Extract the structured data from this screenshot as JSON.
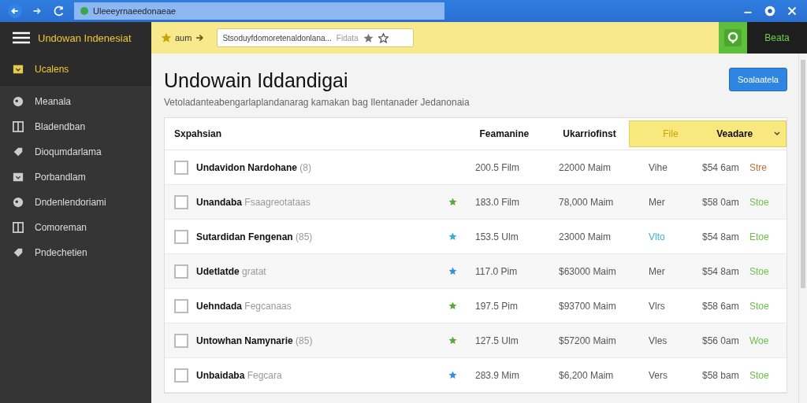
{
  "browser": {
    "address": "Uleeeyrnaeedonaeae"
  },
  "app": {
    "title": "Undowan Indenesiat",
    "shortcut": "aum",
    "search": {
      "value": "Stsoduyfdomoretenaldonlana...",
      "hint": "Fidata"
    },
    "account": "Beata"
  },
  "sidebar": {
    "items": [
      {
        "label": "Ucalens",
        "selected": true
      },
      {
        "label": "Meanala",
        "selected": false
      },
      {
        "label": "Bladendban",
        "selected": false
      },
      {
        "label": "Dioqumdarlama",
        "selected": false
      },
      {
        "label": "Porbandlam",
        "selected": false
      },
      {
        "label": "Dndenlendoriami",
        "selected": false
      },
      {
        "label": "Comoreman",
        "selected": false
      },
      {
        "label": "Pndechetien",
        "selected": false
      }
    ]
  },
  "page": {
    "title": "Undowain Iddandigai",
    "subtitle": "Vetoladanteabengarlaplandanarag kamakan bag Ilentanader Jedanonaia",
    "button": "Soalaatela"
  },
  "table": {
    "columns": [
      {
        "label": "Sxpahsian",
        "highlighted": false
      },
      {
        "label": "Feamanine",
        "highlighted": false
      },
      {
        "label": "Ukarriofinst",
        "highlighted": false
      },
      {
        "label": "File",
        "highlighted": true
      },
      {
        "label": "Veadare",
        "highlighted": true
      }
    ],
    "rows": [
      {
        "checked": false,
        "name": "**Undavidon Nardohane** (8)",
        "size": "200.5 Film",
        "count": "22000 Maim",
        "type": {
          "text": "Vihe"
        },
        "price": "$54 6am",
        "status": {
          "text": "Stre",
          "color": "#c0703a"
        }
      },
      {
        "checked": false,
        "name": "**Unandaba** Fsaagreotataas",
        "star": {
          "color": "#5aa83a"
        },
        "size": "183.0 Film",
        "count": "78,000 Maim",
        "type": {
          "text": "Mer"
        },
        "price": "$58 0am",
        "status": {
          "text": "Stoe",
          "color": "#6cc04a"
        }
      },
      {
        "checked": false,
        "name": "**Sutardidan Fengenan** (85)",
        "star": {
          "color": "#3bb0c9"
        },
        "size": "153.5 Ulm",
        "count": "23000 Maim",
        "type": {
          "text": "Vlto",
          "color": "#3bb0c9"
        },
        "price": "$54 8am",
        "status": {
          "text": "Etoe",
          "color": "#6cc04a"
        }
      },
      {
        "checked": false,
        "name": "**Udetlatde** gratat",
        "star": {
          "color": "#3a8ee0"
        },
        "size": "117.0 Pim",
        "count": "$63000 Maim",
        "type": {
          "text": "Mer"
        },
        "price": "$54 8am",
        "status": {
          "text": "Stoe",
          "color": "#6cc04a"
        }
      },
      {
        "checked": false,
        "name": "**Uehndada** Fegcanaas",
        "star": {
          "color": "#5aa83a"
        },
        "size": "197.5 Pim",
        "count": "$93700 Maim",
        "type": {
          "text": "Vlrs"
        },
        "price": "$58 6am",
        "status": {
          "text": "Stoe",
          "color": "#6cc04a"
        }
      },
      {
        "checked": false,
        "name": "**Untowhan Namynarie** (85)",
        "star": {
          "color": "#5aa83a"
        },
        "size": "127.5 Ulm",
        "count": "$57200 Maim",
        "type": {
          "text": "Vles"
        },
        "price": "$56 0am",
        "status": {
          "text": "Woe",
          "color": "#6cc04a"
        }
      },
      {
        "checked": false,
        "name": "**Unbaidaba** Fegcara",
        "star": {
          "color": "#3a8ee0"
        },
        "size": "283.9 Mim",
        "count": "$6,200 Maim",
        "type": {
          "text": "Vers"
        },
        "price": "$58 bam",
        "status": {
          "text": "Stoe",
          "color": "#6cc04a"
        }
      }
    ]
  }
}
